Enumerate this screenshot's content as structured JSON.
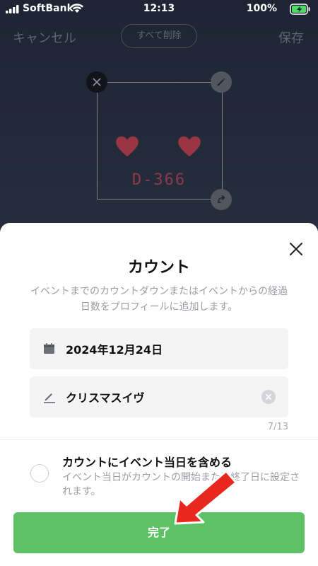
{
  "status_bar": {
    "carrier": "SoftBank",
    "time": "12:13",
    "battery": "100%"
  },
  "editor": {
    "cancel_label": "キャンセル",
    "clear_all_label": "すべて削除",
    "save_label": "保存",
    "sticker_text": "D-366"
  },
  "sheet": {
    "title": "カウント",
    "description": "イベントまでのカウントダウンまたはイベントからの経過日数をプロフィールに追加します。",
    "date_value": "2024年12月24日",
    "event_name_value": "クリスマスイヴ",
    "char_count": "7/13",
    "include_day_title": "カウントにイベント当日を含める",
    "include_day_desc": "イベント当日がカウントの開始または終了日に設定されます。",
    "done_label": "完了"
  },
  "colors": {
    "accent_green": "#5dc266",
    "arrow_red": "#e8281e",
    "heart_red": "#c23a4a"
  },
  "icons": [
    "signal-icon",
    "wifi-icon",
    "battery-charging-icon",
    "close-icon",
    "pencil-icon",
    "rotate-icon",
    "heart-icon",
    "calendar-icon",
    "clear-icon",
    "arrow-icon"
  ]
}
